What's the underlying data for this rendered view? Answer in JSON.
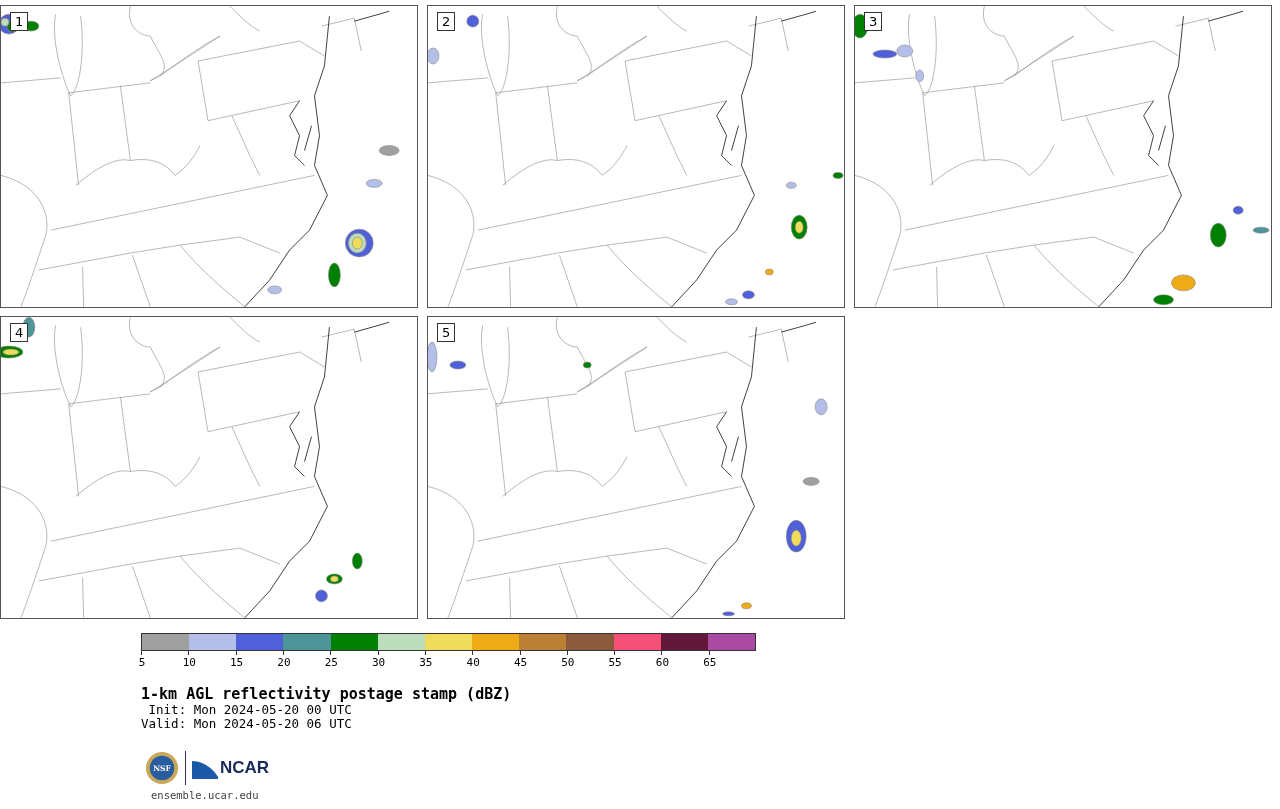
{
  "panels": [
    {
      "label": "1"
    },
    {
      "label": "2"
    },
    {
      "label": "3"
    },
    {
      "label": "4"
    },
    {
      "label": "5"
    }
  ],
  "colorbar": {
    "bins": [
      {
        "color": "#a0a0a0"
      },
      {
        "color": "#b4bfe9"
      },
      {
        "color": "#5060d8"
      },
      {
        "color": "#4e9599"
      },
      {
        "color": "#008000"
      },
      {
        "color": "#bcdcbc"
      },
      {
        "color": "#eedc5a"
      },
      {
        "color": "#efaa18"
      },
      {
        "color": "#bb8033"
      },
      {
        "color": "#8b5a3c"
      },
      {
        "color": "#f55078"
      },
      {
        "color": "#621838"
      },
      {
        "color": "#aa4aa2"
      }
    ],
    "ticks": [
      "5",
      "10",
      "15",
      "20",
      "25",
      "30",
      "35",
      "40",
      "45",
      "50",
      "55",
      "60",
      "65"
    ]
  },
  "title": "1-km AGL reflectivity postage stamp (dBZ)",
  "init": " Init: Mon 2024-05-20 00 UTC",
  "valid": "Valid: Mon 2024-05-20 06 UTC",
  "logo": {
    "nsf": "NSF",
    "ncar": "NCAR"
  },
  "url": "ensemble.ucar.edu"
}
